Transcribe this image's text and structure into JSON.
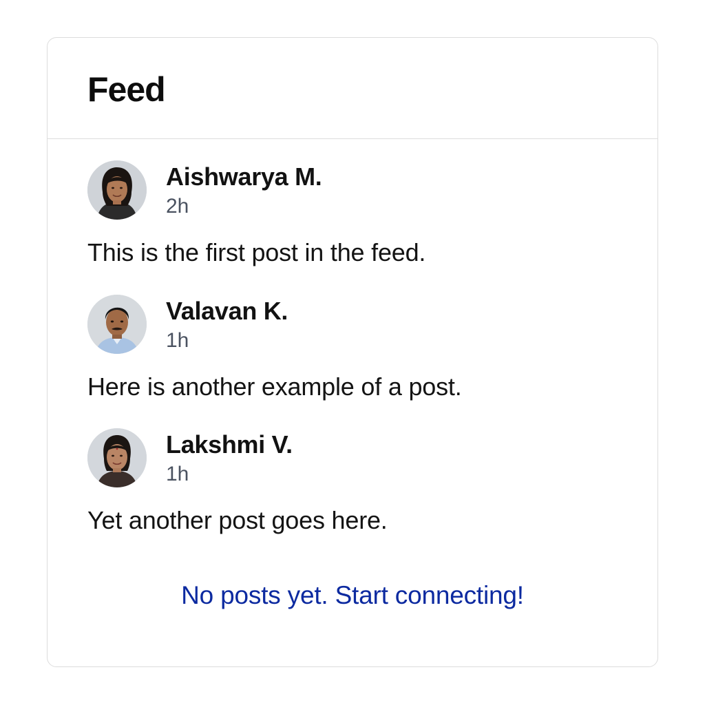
{
  "feed": {
    "title": "Feed",
    "posts": [
      {
        "author": "Aishwarya M.",
        "time": "2h",
        "text": "This is the first post in the feed.",
        "avatar_icon": "woman-portrait"
      },
      {
        "author": "Valavan K.",
        "time": "1h",
        "text": "Here is another example of a post.",
        "avatar_icon": "man-portrait"
      },
      {
        "author": "Lakshmi V.",
        "time": "1h",
        "text": "Yet another post goes here.",
        "avatar_icon": "woman-portrait"
      }
    ],
    "empty_message": "No posts yet. Start connecting!"
  },
  "colors": {
    "link": "#0c2aa0",
    "border": "#dcdcdc",
    "secondary_text": "#4a5260"
  }
}
